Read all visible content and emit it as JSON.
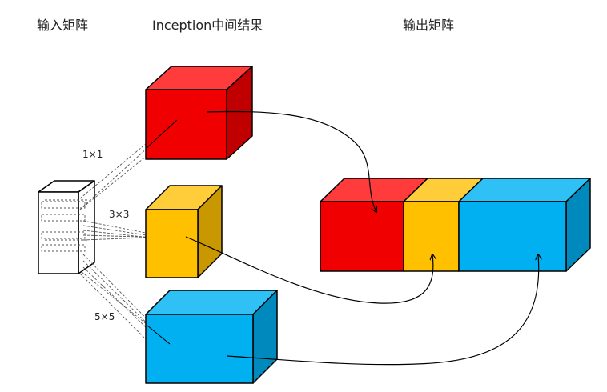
{
  "labels": {
    "input_matrix": "输入矩阵",
    "intermediate": "Inception中间结果",
    "output_matrix": "输出矩阵",
    "conv_1x1": "1×1",
    "conv_3x3": "3×3",
    "conv_5x5": "5×5"
  },
  "colors": {
    "red_front": "#f00000",
    "red_top": "#ff3b3b",
    "red_side": "#c00000",
    "yellow_front": "#ffc000",
    "yellow_top": "#ffcd3a",
    "yellow_side": "#c99700",
    "blue_front": "#00b0f0",
    "blue_top": "#2fc1f5",
    "blue_side": "#0089bd",
    "input_fill": "#ffffff"
  }
}
